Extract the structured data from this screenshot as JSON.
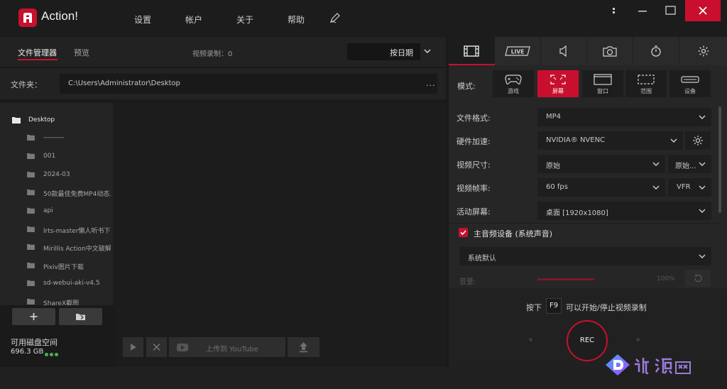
{
  "app": {
    "title": "Action!"
  },
  "menu": [
    "设置",
    "帐户",
    "关于",
    "帮助"
  ],
  "left": {
    "tabs": {
      "file_manager": "文件管理器",
      "preview": "预览"
    },
    "recording_count": "视频录制：0",
    "sort": "按日期",
    "folder_label": "文件夹：",
    "folder_path": "C:\\Users\\Administrator\\Desktop",
    "folder_more": "...",
    "tree": {
      "root": "Desktop",
      "items": [
        "---------",
        "001",
        "2024-03",
        "50款最佳免费MP4动态...",
        "api",
        "lrts-master懒人听书下载",
        "Mirillis Action中文破解版",
        "Pixiv图片下载",
        "sd-webui-aki-v4.5",
        "ShareX截图"
      ]
    },
    "disk": {
      "label": "可用磁盘空间",
      "value": "696.3 GB"
    },
    "upload_youtube": "上传到 YouTube"
  },
  "right": {
    "mode_label": "模式:",
    "modes": [
      "游戏",
      "屏幕",
      "窗口",
      "范围",
      "设备"
    ],
    "active_mode": "屏幕",
    "settings": {
      "format_label": "文件格式:",
      "format": "MP4",
      "hw_label": "硬件加速:",
      "hw": "NVIDIA® NVENC",
      "size_label": "视频尺寸:",
      "size": "原始",
      "size2": "原始...",
      "fps_label": "视频帧率:",
      "fps": "60 fps",
      "fps_mode": "VFR",
      "screen_label": "活动屏幕:",
      "screen": "桌面 [1920x1080]"
    },
    "audio": {
      "label": "主音频设备 (系统声音)",
      "device": "系统默认",
      "volume_label": "音量:",
      "volume_pct": "100%",
      "volume_level": 1.0
    },
    "hint": {
      "prefix": "按下",
      "key": "F9",
      "suffix": "可以开始/停止视频录制"
    },
    "rec": "REC"
  },
  "colors": {
    "accent": "#c8102e",
    "disk_ok": "#4cb050"
  }
}
